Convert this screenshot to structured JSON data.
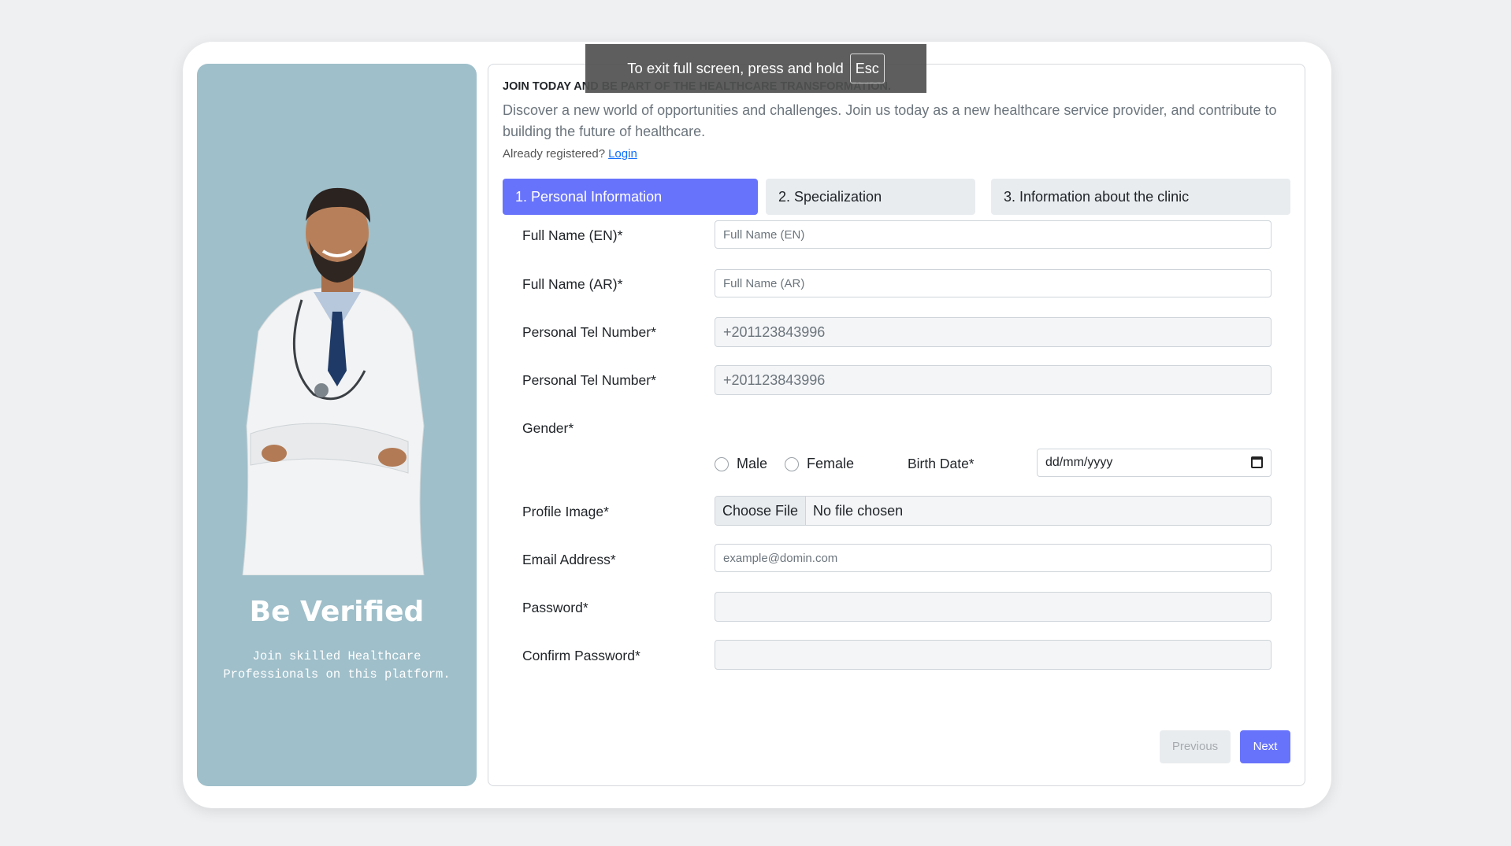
{
  "fullscreen_notice": {
    "text": "To exit full screen, press and hold",
    "key": "Esc"
  },
  "side": {
    "title": "Be Verified",
    "subtitle_line1": "Join skilled Healthcare",
    "subtitle_line2": "Professionals on this platform."
  },
  "header": {
    "join": "JOIN TODAY AND BE PART OF THE HEALTHCARE TRANSFORMATION.",
    "description": "Discover a new world of opportunities and challenges. Join us today as a new healthcare service provider, and contribute to building the future of healthcare.",
    "already": "Already registered?",
    "login": "Login"
  },
  "steps": [
    {
      "label": "1. Personal Information",
      "active": true
    },
    {
      "label": "2. Specialization",
      "active": false
    },
    {
      "label": "3. Information about the clinic",
      "active": false
    }
  ],
  "form": {
    "full_name_en": {
      "label": "Full Name (EN)*",
      "placeholder": "Full Name (EN)"
    },
    "full_name_ar": {
      "label": "Full Name (AR)*",
      "placeholder": "Full Name (AR)"
    },
    "tel1": {
      "label": "Personal Tel Number*",
      "value": "+201123843996"
    },
    "tel2": {
      "label": "Personal Tel Number*",
      "value": "+201123843996"
    },
    "gender": {
      "label": "Gender*",
      "male": "Male",
      "female": "Female"
    },
    "birth_date": {
      "label": "Birth Date*",
      "placeholder": "dd/mm/yyyy"
    },
    "profile_image": {
      "label": "Profile Image*",
      "button": "Choose File",
      "status": "No file chosen"
    },
    "email": {
      "label": "Email Address*",
      "placeholder": "example@domin.com"
    },
    "password": {
      "label": "Password*"
    },
    "confirm_password": {
      "label": "Confirm Password*"
    }
  },
  "buttons": {
    "previous": "Previous",
    "next": "Next"
  },
  "colors": {
    "accent": "#6873fb",
    "side_bg": "#9fbfca"
  }
}
